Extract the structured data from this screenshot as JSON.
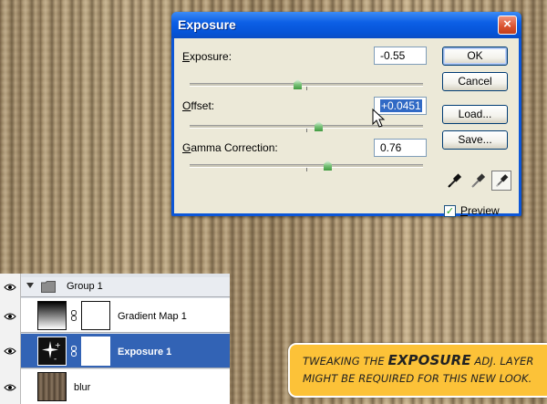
{
  "dialog": {
    "title": "Exposure",
    "close_glyph": "×",
    "rows": [
      {
        "label": "Exposure:",
        "value": "-0.55",
        "slider_fraction": 0.46
      },
      {
        "label": "Offset:",
        "value": "+0.0451",
        "slider_fraction": 0.55
      },
      {
        "label": "Gamma Correction:",
        "value": "0.76",
        "slider_fraction": 0.59
      }
    ],
    "buttons": {
      "ok": "OK",
      "cancel": "Cancel",
      "load": "Load...",
      "save": "Save..."
    },
    "eyedroppers": [
      "black-point-eyedropper-icon",
      "gray-point-eyedropper-icon",
      "white-point-eyedropper-icon"
    ],
    "preview": {
      "label": "Preview",
      "checked": true
    }
  },
  "layers": {
    "group": {
      "name": "Group 1"
    },
    "items": [
      {
        "name": "Gradient Map 1",
        "selected": false
      },
      {
        "name": "Exposure 1",
        "selected": true
      },
      {
        "name": "blur",
        "selected": false
      }
    ]
  },
  "annotation": {
    "pre": "TWEAKING THE ",
    "emphasis": "EXPOSURE",
    "post": " ADJ. LAYER MIGHT BE REQUIRED FOR THIS NEW LOOK."
  },
  "colors": {
    "title_bar": "#0c5fe6",
    "dialog_face": "#ece9d8",
    "selected_layer": "#3263b5",
    "annotation_bg": "#fcc238",
    "slider_thumb": "#4fa84f"
  }
}
